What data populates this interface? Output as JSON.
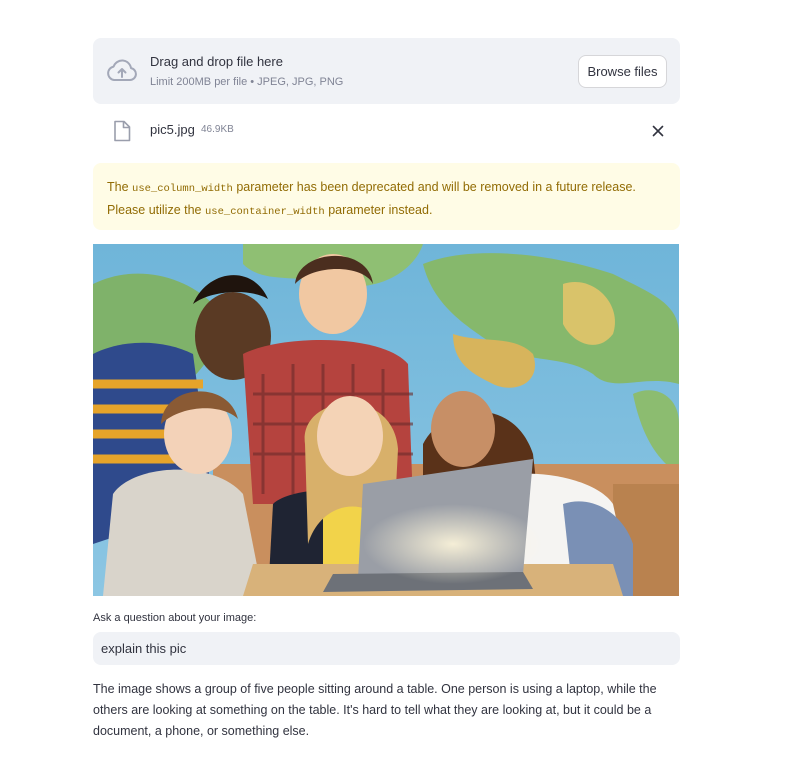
{
  "uploader": {
    "title": "Drag and drop file here",
    "limit_text": "Limit 200MB per file • JPEG, JPG, PNG",
    "browse_label": "Browse files",
    "icon": "cloud-upload-icon"
  },
  "uploaded_file": {
    "name": "pic5.jpg",
    "size": "46.9KB",
    "file_icon": "file-icon",
    "remove_icon": "close-icon"
  },
  "warning": {
    "part1": "The ",
    "code1": "use_column_width",
    "part2": " parameter has been deprecated and will be removed in a future release. Please utilize the ",
    "code2": "use_container_width",
    "part3": " parameter instead."
  },
  "question": {
    "label": "Ask a question about your image:",
    "value": "explain this pic"
  },
  "answer": {
    "text": "The image shows a group of five people sitting around a table. One person is using a laptop, while the others are looking at something on the table. It's hard to tell what they are looking at, but it could be a document, a phone, or something else."
  },
  "colors": {
    "background": "#ffffff",
    "dropzone_bg": "#f0f2f6",
    "warning_bg": "#fffce6",
    "warning_text": "#926c05",
    "text": "#31333f",
    "muted": "#808495"
  }
}
